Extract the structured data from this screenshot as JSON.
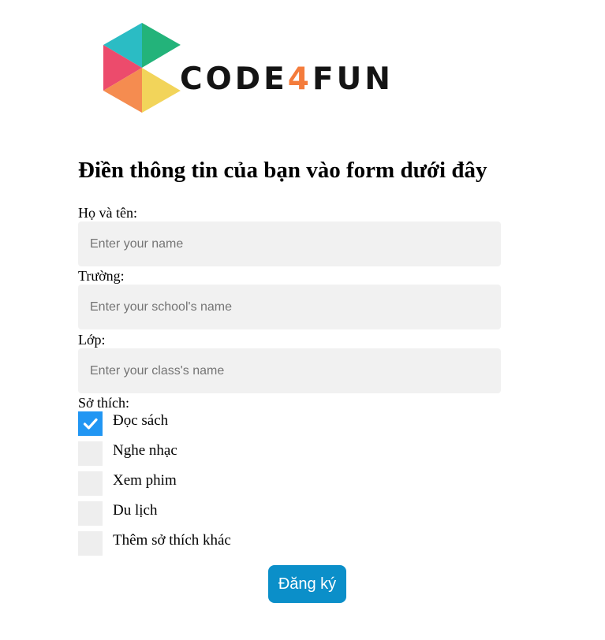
{
  "brand": {
    "text_prefix": "CODE",
    "text_digit": "4",
    "text_suffix": "FUN",
    "colors": {
      "teal": "#2bbcc4",
      "green": "#23b37a",
      "pink": "#ec4b6c",
      "orange": "#f58c50",
      "yellow": "#f2d45a",
      "digit": "#f47c3c"
    }
  },
  "form": {
    "heading": "Điền thông tin của bạn vào form dưới đây",
    "fields": [
      {
        "label": "Họ và tên:",
        "placeholder": "Enter your name",
        "value": ""
      },
      {
        "label": "Trường:",
        "placeholder": "Enter your school's name",
        "value": ""
      },
      {
        "label": "Lớp:",
        "placeholder": "Enter your class's name",
        "value": ""
      }
    ],
    "hobbies_label": "Sở thích:",
    "hobbies": [
      {
        "label": "Đọc sách",
        "checked": true
      },
      {
        "label": "Nghe nhạc",
        "checked": false
      },
      {
        "label": "Xem phim",
        "checked": false
      },
      {
        "label": "Du lịch",
        "checked": false
      },
      {
        "label": "Thêm sở thích khác",
        "checked": false
      }
    ],
    "submit_label": "Đăng ký"
  },
  "colors": {
    "input_bg": "#f1f1f1",
    "checkbox_unchecked": "#eeeeee",
    "checkbox_checked": "#2196f3",
    "button_bg": "#0b8fc9",
    "button_text": "#ffffff"
  },
  "icons": {
    "logo": "hexagon-logo-icon",
    "checkmark": "checkmark-icon"
  }
}
